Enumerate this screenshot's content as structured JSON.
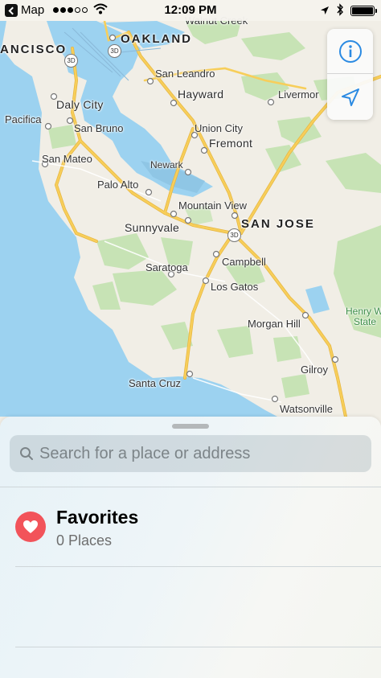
{
  "status_bar": {
    "back_app": "Map",
    "time": "12:09 PM",
    "signal_bars_filled": 3,
    "signal_bars_total": 5,
    "battery_level": 1.0,
    "icons": [
      "back-icon",
      "signal-icon",
      "wifi-icon",
      "location-arrow-icon",
      "bluetooth-icon",
      "battery-icon"
    ]
  },
  "map": {
    "labels": {
      "walnut_creek": "Walnut Creek",
      "francisco": "ANCISCO",
      "oakland": "OAKLAND",
      "san_leandro": "San Leandro",
      "hayward": "Hayward",
      "livermore": "Livermor",
      "daly_city": "Daly City",
      "pacifica": "Pacifica",
      "san_bruno": "San Bruno",
      "union_city": "Union City",
      "fremont": "Fremont",
      "san_mateo": "San Mateo",
      "newark": "Newark",
      "palo_alto": "Palo Alto",
      "mountain_view": "Mountain View",
      "san_jose": "SAN JOSE",
      "sunnyvale": "Sunnyvale",
      "saratoga": "Saratoga",
      "campbell": "Campbell",
      "los_gatos": "Los Gatos",
      "henry_line1": "Henry W",
      "henry_line2": "State",
      "morgan_hill": "Morgan Hill",
      "santa_cruz": "Santa Cruz",
      "gilroy": "Gilroy",
      "watsonville": "Watsonville"
    },
    "badges": [
      "3D",
      "3D",
      "3D"
    ],
    "colors": {
      "water": "#9cd2f0",
      "land": "#f1eee6",
      "park": "#c7e3b5",
      "highway": "#f7ce5a",
      "highway_casing": "#e6b53f"
    }
  },
  "map_controls": {
    "info_icon": "info-icon",
    "tracking_icon": "location-arrow-icon",
    "accent": "#2b8ae2"
  },
  "sheet": {
    "search": {
      "placeholder": "Search for a place or address",
      "value": ""
    },
    "favorites": {
      "title": "Favorites",
      "subtitle": "0 Places",
      "icon": "heart-icon",
      "icon_color": "#f2535a"
    }
  }
}
